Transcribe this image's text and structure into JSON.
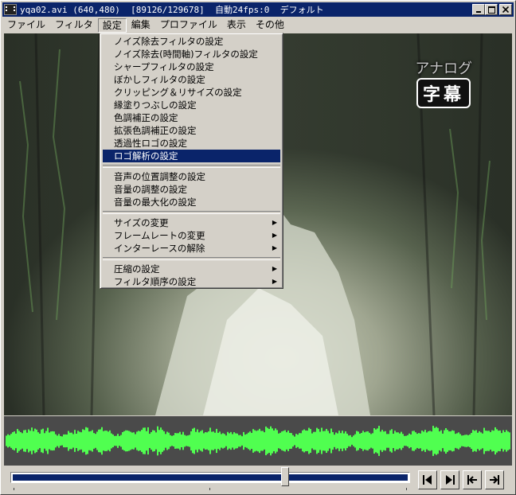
{
  "window": {
    "title": "yqa02.avi (640,480)  [89126/129678]  自動24fps:0  デフォルト",
    "icon": "film-icon"
  },
  "menubar": {
    "items": [
      "ファイル",
      "フィルタ",
      "設定",
      "編集",
      "プロファイル",
      "表示",
      "その他"
    ],
    "active": "設定"
  },
  "settings_menu": {
    "groups": [
      [
        {
          "label": "ノイズ除去フィルタの設定"
        },
        {
          "label": "ノイズ除去(時間軸)フィルタの設定"
        },
        {
          "label": "シャープフィルタの設定"
        },
        {
          "label": "ぼかしフィルタの設定"
        },
        {
          "label": "クリッピング＆リサイズの設定"
        },
        {
          "label": "縁塗りつぶしの設定"
        },
        {
          "label": "色調補正の設定"
        },
        {
          "label": "拡張色調補正の設定"
        },
        {
          "label": "透過性ロゴの設定"
        },
        {
          "label": "ロゴ解析の設定"
        }
      ],
      [
        {
          "label": "音声の位置調整の設定"
        },
        {
          "label": "音量の調整の設定"
        },
        {
          "label": "音量の最大化の設定"
        }
      ],
      [
        {
          "label": "サイズの変更"
        },
        {
          "label": "フレームレートの変更"
        },
        {
          "label": "インターレースの解除"
        }
      ],
      [
        {
          "label": "圧縮の設定"
        },
        {
          "label": "フィルタ順序の設定"
        }
      ]
    ],
    "selected": "ロゴ解析の設定"
  },
  "video": {
    "osd_text_1": "アナログ",
    "osd_text_2": "字幕"
  },
  "seek": {
    "position": 0.687
  },
  "colors": {
    "titlebar": "#0a246a",
    "waveform": "#50ff50",
    "seek_fill": "#0a246a"
  },
  "nav_buttons": [
    "prev-frame-icon",
    "next-frame-icon",
    "prev-keyframe-icon",
    "next-keyframe-icon"
  ]
}
